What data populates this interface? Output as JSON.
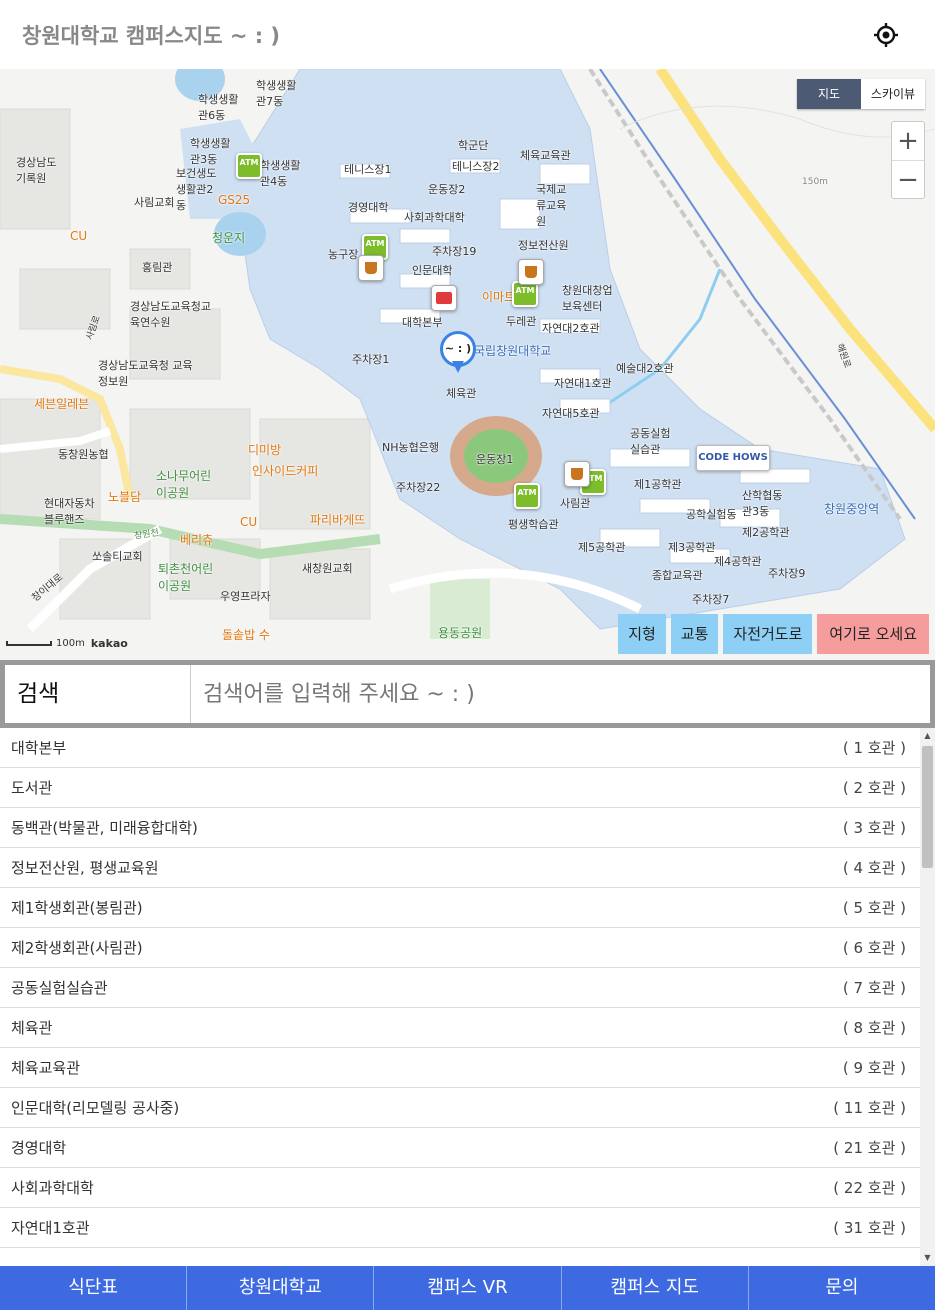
{
  "header": {
    "title": "창원대학교 캠퍼스지도 ~ : )",
    "locate_icon": "crosshair-icon"
  },
  "map": {
    "toggle": {
      "map_label": "지도",
      "skyview_label": "스카이뷰"
    },
    "zoom": {
      "in_label": "+",
      "out_label": "−"
    },
    "labels": {
      "campus_name": "국립창원대학교",
      "gym": "체육관",
      "admin": "대학본부",
      "humanities": "인문대학",
      "parking1": "주차장1",
      "parking19": "주차장19",
      "parking22": "주차장22",
      "parking7": "주차장7",
      "parking9": "주차장9",
      "tennis1": "테니스장1",
      "tennis2": "테니스장2",
      "field2": "운동장2",
      "field1": "운동장1",
      "business": "경영대학",
      "social": "사회과학대학",
      "phys_ed": "체육교육관",
      "intl": "국제교류교육원",
      "info": "정보전산원",
      "nh": "NH농협은행",
      "emart": "이마트",
      "changup": "창원대창업보육센터",
      "science2": "자연대2호관",
      "science1": "자연대1호관",
      "science5": "자연대5호관",
      "art2": "예술대2호관",
      "eng1": "제1공학관",
      "eng2": "제2공학관",
      "eng3": "제3공학관",
      "eng4": "제4공학관",
      "eng5": "제5공학관",
      "general_edu": "종합교육관",
      "lifelong": "평생학습관",
      "sarim": "사림관",
      "station": "창원중앙역",
      "yongdong": "용동공원",
      "cheongun": "청운지",
      "gs25": "GS25",
      "cu1": "CU",
      "cu2": "CU",
      "seven": "세븐일레븐",
      "paris": "파리바게뜨",
      "nobles": "노블담",
      "insideout": "인사이드커피",
      "dimibang": "디미방",
      "sarim_church": "사림교회",
      "new_church": "새창원교회",
      "dongchang_nh": "동창원농협",
      "hyundai": "현대자동차블루핸즈",
      "ssol": "쏘솔티교회",
      "sonamu": "소나무어린이공원",
      "toechon": "퇴촌천어린이공원",
      "woyoung": "우영프라자",
      "dolsot": "돌솥밥 수",
      "edu_office": "경상남도교육청교육연수원",
      "edu_info": "경상남도교육청 교육정보원",
      "archive": "경상남도기록원",
      "bellini": "베리츄",
      "hongrim": "홍림관",
      "nongu": "농구장",
      "dure": "두레관",
      "dorm6": "학생생활관6동",
      "dorm7": "학생생활관7동",
      "dorm3": "학생생활관3동",
      "dorm4": "학생생활관4동",
      "dorm2": "보건생도생활관2동",
      "gongdong": "공동실험실습관",
      "hakgun": "학군단",
      "sandong": "산학협동관3동",
      "gongsil": "공학실험동",
      "elev": "150m",
      "changi": "창이대로",
      "changwon_road": "창원천",
      "haksanro": "해원로",
      "sarim_ro": "사림로",
      "codehows": "CODE HOWS"
    },
    "pin_label": "~ : )",
    "atm_label": "ATM",
    "scale": {
      "distance": "100m",
      "brand": "kakao"
    },
    "layer_buttons": [
      "지형",
      "교통",
      "자전거도로"
    ],
    "come_here_label": "여기로 오세요"
  },
  "search": {
    "label": "검색",
    "placeholder": "검색어를 입력해 주세요 ~ : )",
    "value": ""
  },
  "buildings": [
    {
      "name": "대학본부",
      "num": "( 1 호관 )"
    },
    {
      "name": "도서관",
      "num": "( 2 호관 )"
    },
    {
      "name": "동백관(박물관, 미래융합대학)",
      "num": "( 3 호관 )"
    },
    {
      "name": "정보전산원, 평생교육원",
      "num": "( 4 호관 )"
    },
    {
      "name": "제1학생회관(봉림관)",
      "num": "( 5 호관 )"
    },
    {
      "name": "제2학생회관(사림관)",
      "num": "( 6 호관 )"
    },
    {
      "name": "공동실험실습관",
      "num": "( 7 호관 )"
    },
    {
      "name": "체육관",
      "num": "( 8 호관 )"
    },
    {
      "name": "체육교육관",
      "num": "( 9 호관 )"
    },
    {
      "name": "인문대학(리모델링 공사중)",
      "num": "( 11 호관 )"
    },
    {
      "name": "경영대학",
      "num": "( 21 호관 )"
    },
    {
      "name": "사회과학대학",
      "num": "( 22 호관 )"
    },
    {
      "name": "자연대1호관",
      "num": "( 31 호관 )"
    }
  ],
  "bottom_nav": [
    "식단표",
    "창원대학교",
    "캠퍼스 VR",
    "캠퍼스 지도",
    "문의"
  ],
  "colors": {
    "nav_bg": "#3d6ae0",
    "layer_btn": "#8ed0f5",
    "come_btn": "#f59d9d",
    "campus_fill": "#cfe0f3"
  }
}
